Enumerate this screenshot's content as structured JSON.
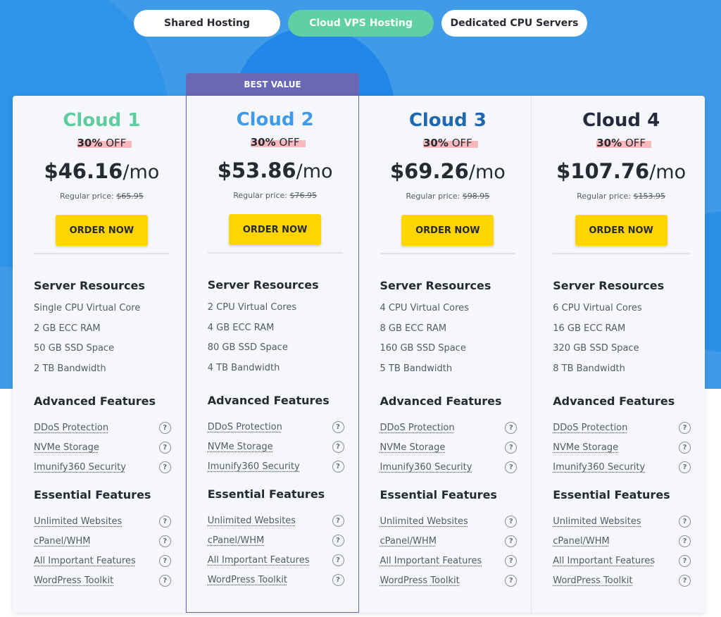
{
  "tabs": [
    {
      "label": "Shared Hosting"
    },
    {
      "label": "Cloud VPS Hosting",
      "active": true
    },
    {
      "label": "Dedicated CPU Servers"
    }
  ],
  "badge": "BEST VALUE",
  "colors": {
    "hero": "#3f9be8",
    "tab_active": "#5fd0a3",
    "badge": "#6a68b4",
    "order_button": "#ffd500",
    "cloud1": "#5fcca0",
    "cloud2": "#3f9be8",
    "cloud3": "#1f68b0",
    "cloud4": "#262a3f"
  },
  "common": {
    "discount_pct": "30%",
    "discount_off": "OFF",
    "per": "/mo",
    "regular_label": "Regular price: ",
    "order_label": "ORDER NOW",
    "server_resources": "Server Resources",
    "advanced_features": "Advanced Features",
    "essential_features": "Essential Features",
    "help_icon": "?"
  },
  "plans": [
    {
      "name": "Cloud 1",
      "price": "$46.16",
      "regular": "$65.95",
      "resources": [
        "Single CPU Virtual Core",
        "2 GB ECC RAM",
        "50 GB SSD Space",
        "2 TB Bandwidth"
      ]
    },
    {
      "name": "Cloud 2",
      "price": "$53.86",
      "regular": "$76.95",
      "resources": [
        "2 CPU Virtual Cores",
        "4 GB ECC RAM",
        "80 GB SSD Space",
        "4 TB Bandwidth"
      ]
    },
    {
      "name": "Cloud 3",
      "price": "$69.26",
      "regular": "$98.95",
      "resources": [
        "4 CPU Virtual Cores",
        "8 GB ECC RAM",
        "160 GB SSD Space",
        "5 TB Bandwidth"
      ]
    },
    {
      "name": "Cloud 4",
      "price": "$107.76",
      "regular": "$153.95",
      "resources": [
        "6 CPU Virtual Cores",
        "16 GB ECC RAM",
        "320 GB SSD Space",
        "8 TB Bandwidth"
      ]
    }
  ],
  "advanced": [
    "DDoS Protection",
    "NVMe Storage",
    "Imunify360 Security"
  ],
  "essential": [
    "Unlimited Websites",
    "cPanel/WHM",
    "All Important Features",
    "WordPress Toolkit"
  ]
}
